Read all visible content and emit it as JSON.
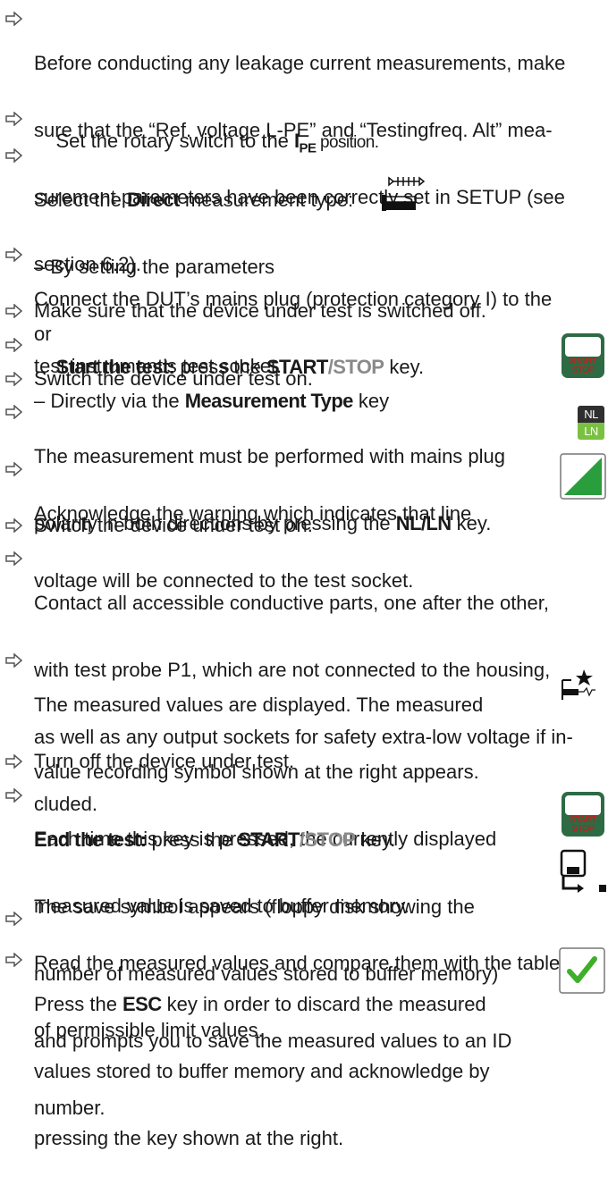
{
  "steps": [
    {
      "lines": [
        "Before conducting any leakage current measurements, make",
        "sure that the “Ref. voltage L-PE” and “Testingfreq. Alt” mea-",
        "surement parameters have been correctly set in SETUP (see",
        "section 6.2)."
      ]
    },
    {
      "pre": "Set the rotary switch to the ",
      "symbol_main": "I",
      "symbol_sub": "PE",
      "post": " position."
    },
    {
      "pre": "Select the ",
      "bold": "Direct",
      "post": " measurement type:",
      "sub1": "– By setting the parameters",
      "sub2": "or",
      "sub3_pre": "– Directly via the ",
      "sub3_bold": "Measurement Type",
      "sub3_post": " key"
    },
    {
      "lines": [
        "Connect the DUT’s mains plug (protection category I) to the",
        "test instrument’s test socket."
      ]
    },
    {
      "lines": [
        "Make sure that the device under test is switched off."
      ]
    },
    {
      "bold": "Start the test:",
      "mid": " press the ",
      "key1": "START",
      "slash": "/",
      "key2": "STOP",
      "post": " key."
    },
    {
      "lines": [
        "Switch the device under test on."
      ]
    },
    {
      "line1": "The measurement must be performed with mains plug",
      "pre": "polarity in both directions by pressing the ",
      "bold": "NL/LN",
      "post": " key."
    },
    {
      "lines": [
        "Acknowledge the warning which indicates that line",
        "voltage will be connected to the test socket."
      ]
    },
    {
      "lines": [
        "Switch the device under test on."
      ]
    },
    {
      "lines": [
        "Contact all accessible conductive parts, one after the other,",
        "with test probe P1, which are not connected to the housing,",
        "as well as any output sockets for safety extra-low voltage if in-",
        "cluded."
      ]
    },
    {
      "lines": [
        "The measured values are displayed. The measured",
        "value recording symbol shown at the right appears.",
        "Each time this key is pressed, the currently displayed",
        "measured value is saved to buffer memory."
      ]
    },
    {
      "lines": [
        "Turn off the device under test."
      ]
    },
    {
      "bold": "End the test:",
      "mid": " press the ",
      "key1": "START",
      "slash": "/",
      "key2": "STOP",
      "post": " key.",
      "lines": [
        "The save symbol appears (floppy disk showing the",
        "number of measured values stored to buffer memory)",
        "and prompts you to save the measured values to an ID",
        "number."
      ]
    },
    {
      "lines": [
        "Read the measured values and compare them with the table",
        "of permissible limit values."
      ]
    },
    {
      "pre": "Press the ",
      "bold": "ESC",
      "post": " key in order to discard the measured",
      "lines": [
        "values stored to buffer memory and acknowledge by",
        "pressing the key shown at the right."
      ]
    }
  ],
  "keys": {
    "start_stop": {
      "label_top": "START",
      "label_bottom": "STOP",
      "body_color": "#2e6b45",
      "label_color": "#b5261e"
    },
    "nl_ln": {
      "top": "NL",
      "bottom": "LN",
      "top_bg": "#2f2f2f",
      "bottom_bg": "#7ac143"
    },
    "warning_color": "#2a9d3c",
    "check_color": "#3fae29"
  }
}
